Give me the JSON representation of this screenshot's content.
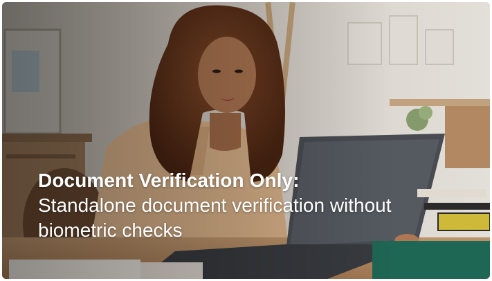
{
  "card": {
    "title": "Document Verification Only:",
    "description": "Standalone document verification without biometric checks"
  },
  "colors": {
    "text": "#ffffff",
    "hair": "#6b3a1f",
    "shirt": "#e2b98e",
    "laptop": "#4b4f55",
    "wall": "#e6e1da"
  },
  "icons": {
    "image": "photo-of-woman-using-laptop"
  }
}
